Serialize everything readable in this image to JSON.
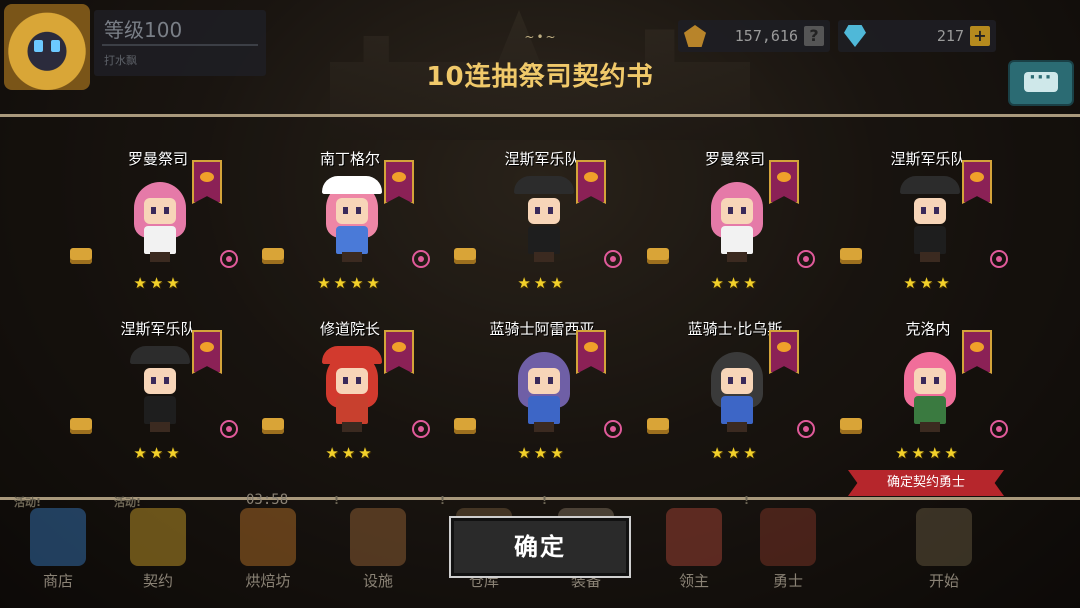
{
  "player": {
    "level_label": "等级100",
    "subtitle": "打水飘"
  },
  "resources": {
    "gold": "157,616",
    "gems": "217",
    "help_label": "?",
    "add_label": "+"
  },
  "dialog": {
    "title": "10连抽祭司契约书",
    "confirm_label": "确定",
    "confirm_tag": "确定契约勇士"
  },
  "heroes": [
    {
      "name": "罗曼祭司",
      "stars": "★★★",
      "star_count": 3,
      "hair": "#e57aa8",
      "body": "#f2f2f2",
      "hat": null
    },
    {
      "name": "南丁格尔",
      "stars": "★★★★",
      "star_count": 4,
      "hair": "#ee86a6",
      "body": "#4a7ad8",
      "hat": "#ffffff"
    },
    {
      "name": "涅斯军乐队",
      "stars": "★★★",
      "star_count": 3,
      "hair": null,
      "body": "#1e1e1e",
      "hat": "#2c2c2c"
    },
    {
      "name": "罗曼祭司",
      "stars": "★★★",
      "star_count": 3,
      "hair": "#e57aa8",
      "body": "#f2f2f2",
      "hat": null
    },
    {
      "name": "涅斯军乐队",
      "stars": "★★★",
      "star_count": 3,
      "hair": null,
      "body": "#1e1e1e",
      "hat": "#2c2c2c"
    },
    {
      "name": "涅斯军乐队",
      "stars": "★★★",
      "star_count": 3,
      "hair": null,
      "body": "#1e1e1e",
      "hat": "#2c2c2c"
    },
    {
      "name": "修道院长",
      "stars": "★★★",
      "star_count": 3,
      "hair": "#d23a2e",
      "body": "#c8402e",
      "hat": "#d23a2e"
    },
    {
      "name": "蓝骑士阿雷西亚",
      "stars": "★★★",
      "star_count": 3,
      "hair": "#6f5fa6",
      "body": "#3d66c6",
      "hat": null
    },
    {
      "name": "蓝骑士·比乌斯",
      "stars": "★★★",
      "star_count": 3,
      "hair": "#3a3a3a",
      "body": "#3d66c6",
      "hat": null
    },
    {
      "name": "克洛内",
      "stars": "★★★★",
      "star_count": 4,
      "hair": "#f06e9a",
      "body": "#3a7a40",
      "hat": null
    }
  ],
  "nav": [
    {
      "label": "商店",
      "icon": "shop-icon",
      "badge": "活动!",
      "color": "#3a7fc8"
    },
    {
      "label": "契约",
      "icon": "contract-icon",
      "badge": "活动!",
      "color": "#d6a82c"
    },
    {
      "label": "烘焙坊",
      "icon": "bakery-icon",
      "badge": "",
      "color": "#c0772a"
    },
    {
      "label": "设施",
      "icon": "facility-icon",
      "badge": "!",
      "color": "#a06a3a"
    },
    {
      "label": "仓库",
      "icon": "warehouse-icon",
      "badge": "!",
      "color": "#7a6040"
    },
    {
      "label": "装备",
      "icon": "equipment-icon",
      "badge": "!",
      "color": "#8a7a66"
    },
    {
      "label": "领主",
      "icon": "lord-icon",
      "badge": "",
      "color": "#b44a3a"
    },
    {
      "label": "勇士",
      "icon": "warrior-icon",
      "badge": "!",
      "color": "#8a3a2a"
    },
    {
      "label": "开始",
      "icon": "start-icon",
      "badge": "",
      "color": "#6d5f45"
    }
  ],
  "timer": "03:58"
}
